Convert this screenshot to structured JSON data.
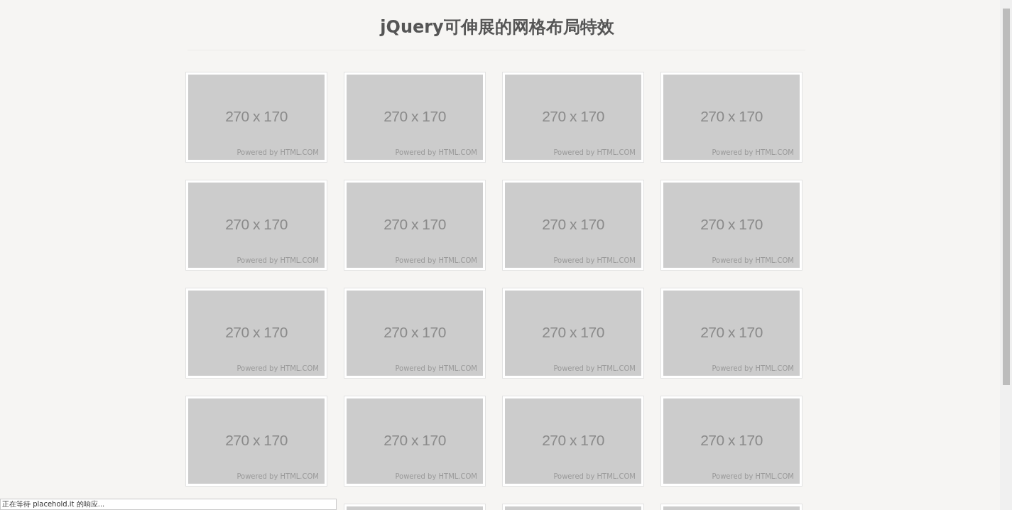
{
  "title": "jQuery可伸展的网格布局特效",
  "cards": [
    {
      "kind": "full",
      "size": "270 x 170",
      "credit": "Powered by HTML.COM"
    },
    {
      "kind": "full",
      "size": "270 x 170",
      "credit": "Powered by HTML.COM"
    },
    {
      "kind": "full",
      "size": "270 x 170",
      "credit": "Powered by HTML.COM"
    },
    {
      "kind": "full",
      "size": "270 x 170",
      "credit": "Powered by HTML.COM"
    },
    {
      "kind": "full",
      "size": "270 x 170",
      "credit": "Powered by HTML.COM"
    },
    {
      "kind": "full",
      "size": "270 x 170",
      "credit": "Powered by HTML.COM"
    },
    {
      "kind": "full",
      "size": "270 x 170",
      "credit": "Powered by HTML.COM"
    },
    {
      "kind": "full",
      "size": "270 x 170",
      "credit": "Powered by HTML.COM"
    },
    {
      "kind": "full",
      "size": "270 x 170",
      "credit": "Powered by HTML.COM"
    },
    {
      "kind": "full",
      "size": "270 x 170",
      "credit": "Powered by HTML.COM"
    },
    {
      "kind": "full",
      "size": "270 x 170",
      "credit": "Powered by HTML.COM"
    },
    {
      "kind": "full",
      "size": "270 x 170",
      "credit": "Powered by HTML.COM"
    },
    {
      "kind": "full",
      "size": "270 x 170",
      "credit": "Powered by HTML.COM"
    },
    {
      "kind": "full",
      "size": "270 x 170",
      "credit": "Powered by HTML.COM"
    },
    {
      "kind": "full",
      "size": "270 x 170",
      "credit": "Powered by HTML.COM"
    },
    {
      "kind": "full",
      "size": "270 x 170",
      "credit": "Powered by HTML.COM"
    },
    {
      "kind": "cut"
    },
    {
      "kind": "cut"
    },
    {
      "kind": "cut"
    }
  ],
  "status_bar": "正在等待 placehold.it 的响应..."
}
